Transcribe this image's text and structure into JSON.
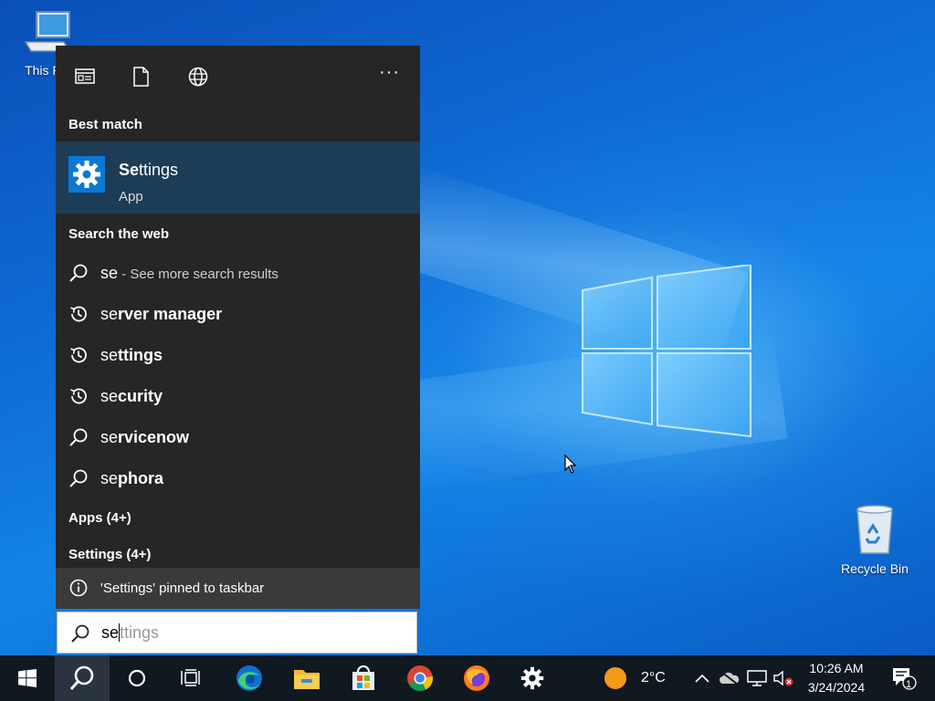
{
  "desktop": {
    "icons": [
      {
        "label": "This PC",
        "icon": "computer-icon"
      },
      {
        "label": "Recycle Bin",
        "icon": "recycle-bin-icon"
      }
    ]
  },
  "search_panel": {
    "filters": [
      "apps-filter-icon",
      "documents-filter-icon",
      "web-filter-icon"
    ],
    "more_label": "···",
    "best_match_header": "Best match",
    "best_match": {
      "title_bold": "Se",
      "title_rest": "ttings",
      "subtitle": "App",
      "icon": "gear-icon"
    },
    "web_header": "Search the web",
    "web_results": [
      {
        "icon": "search-icon",
        "prefix": "se",
        "rest": "",
        "more": " - See more search results"
      },
      {
        "icon": "history-icon",
        "prefix": "se",
        "rest": "rver manager",
        "more": ""
      },
      {
        "icon": "history-icon",
        "prefix": "se",
        "rest": "ttings",
        "more": ""
      },
      {
        "icon": "history-icon",
        "prefix": "se",
        "rest": "curity",
        "more": ""
      },
      {
        "icon": "search-icon",
        "prefix": "se",
        "rest": "rvicenow",
        "more": ""
      },
      {
        "icon": "search-icon",
        "prefix": "se",
        "rest": "phora",
        "more": ""
      }
    ],
    "apps_header": "Apps (4+)",
    "settings_header": "Settings (4+)",
    "notice": "'Settings' pinned to taskbar"
  },
  "search_box": {
    "typed": "se",
    "suggestion": "ttings"
  },
  "taskbar": {
    "weather_temp": "2°C",
    "time": "10:26 AM",
    "date": "3/24/2024",
    "notification_count": "1"
  },
  "colors": {
    "panel_bg": "#262626",
    "best_match_bg": "#1d3c55",
    "accent": "#0d78d4",
    "taskbar_bg": "#101820"
  }
}
